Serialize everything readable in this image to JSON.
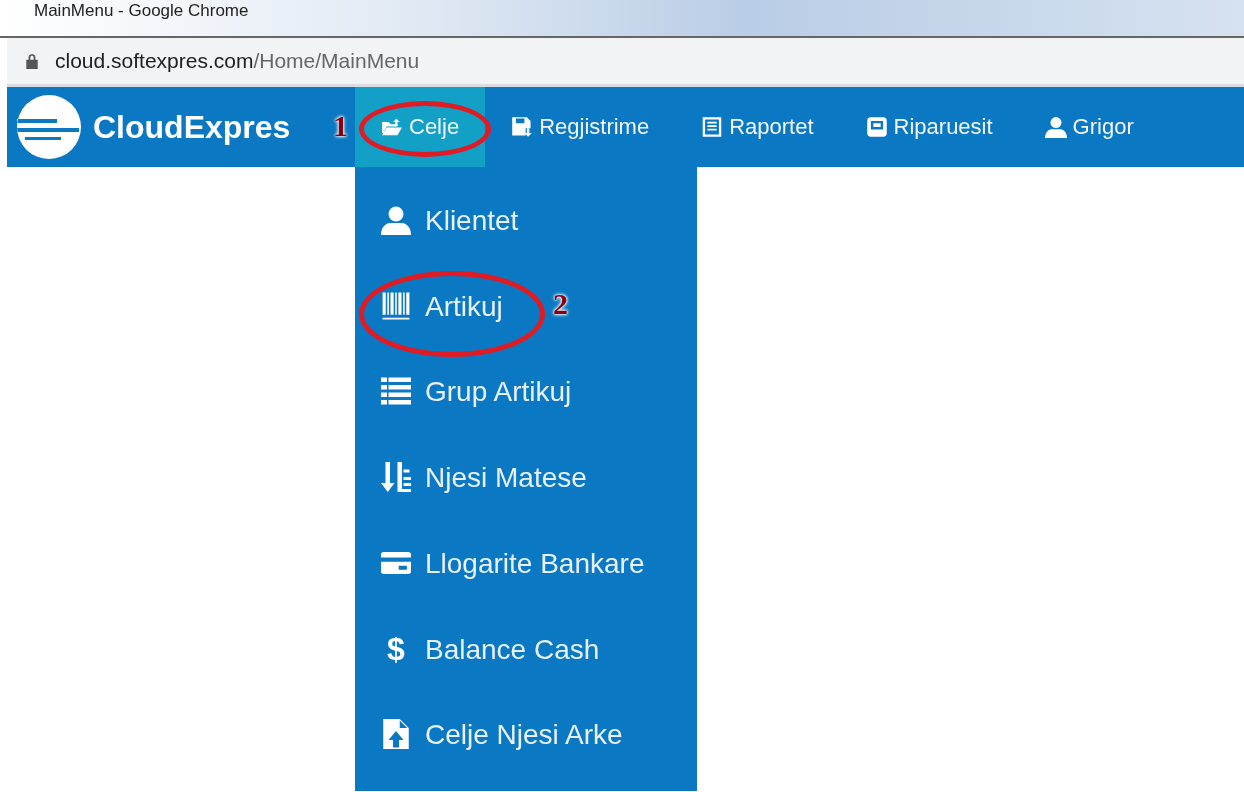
{
  "window": {
    "title": "MainMenu - Google Chrome"
  },
  "address_bar": {
    "host": "cloud.softexpres.com",
    "path": "/Home/MainMenu"
  },
  "navbar": {
    "brand": "CloudExpres",
    "items": [
      {
        "label": "Celje",
        "kind": "folder",
        "selected": true,
        "annotation": "1"
      },
      {
        "label": "Regjistrime",
        "kind": "save",
        "selected": false
      },
      {
        "label": "Raportet",
        "kind": "report",
        "selected": false
      },
      {
        "label": "Riparuesit",
        "kind": "drive",
        "selected": false
      },
      {
        "label": "Grigor",
        "kind": "user",
        "selected": false
      }
    ]
  },
  "dropdown": {
    "items": [
      {
        "label": "Klientet",
        "kind": "user"
      },
      {
        "label": "Artikuj",
        "kind": "barcode",
        "annotation": "2"
      },
      {
        "label": "Grup Artikuj",
        "kind": "list"
      },
      {
        "label": "Njesi Matese",
        "kind": "sort"
      },
      {
        "label": "Llogarite Bankare",
        "kind": "card"
      },
      {
        "label": "Balance Cash",
        "kind": "char",
        "symbol": "$"
      },
      {
        "label": "Celje Njesi Arke",
        "kind": "upload"
      }
    ]
  }
}
